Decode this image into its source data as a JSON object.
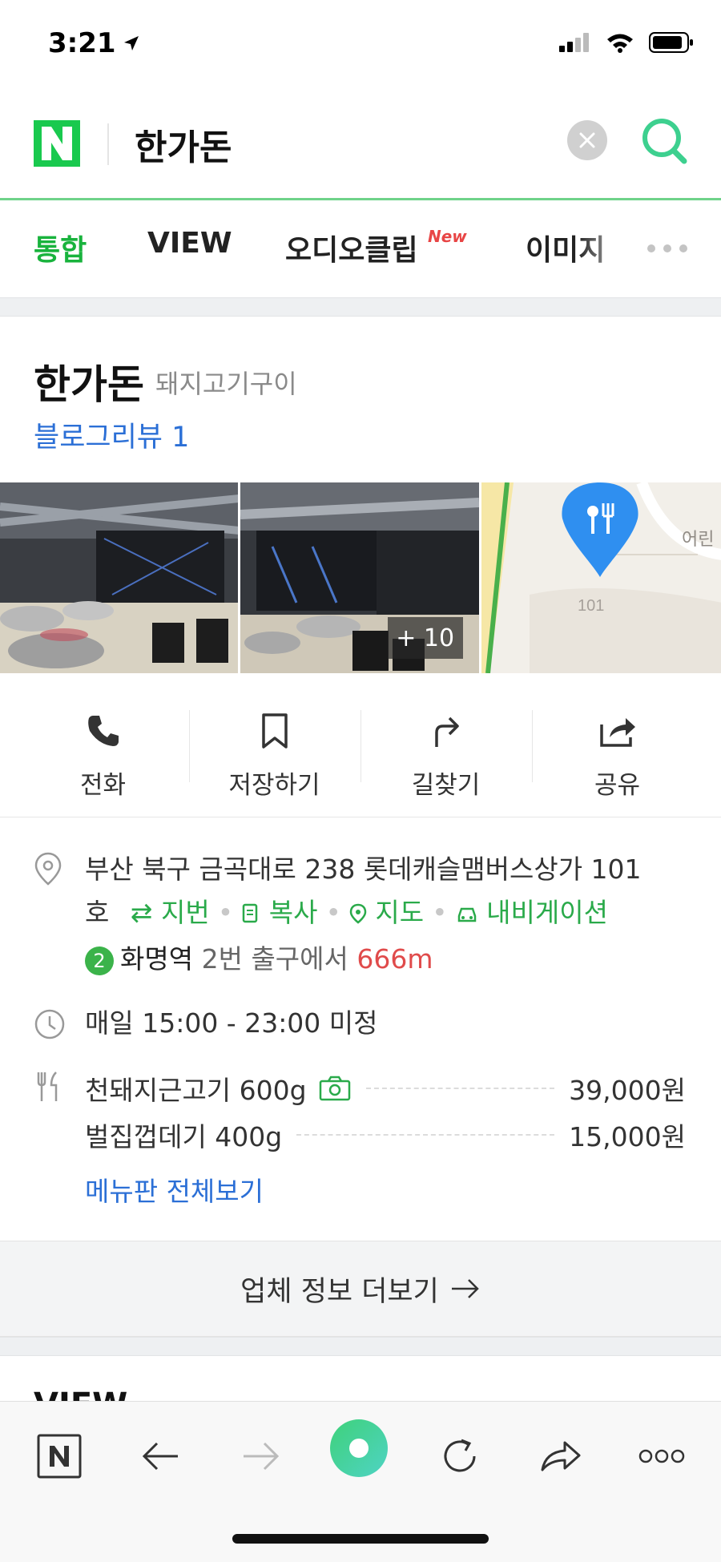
{
  "status_bar": {
    "time": "3:21"
  },
  "search": {
    "query": "한가돈"
  },
  "tabs": [
    {
      "label": "통합",
      "active": true
    },
    {
      "label": "VIEW",
      "active": false
    },
    {
      "label": "오디오클립",
      "active": false,
      "badge": "New"
    },
    {
      "label": "이미지",
      "active": false
    }
  ],
  "place": {
    "name": "한가돈",
    "category": "돼지고기구이",
    "blog_review": "블로그리뷰 1",
    "photo_more": "+ 10",
    "map_labels": {
      "street": "101",
      "nearby": "어린"
    }
  },
  "actions": [
    {
      "label": "전화",
      "icon": "phone-icon"
    },
    {
      "label": "저장하기",
      "icon": "bookmark-icon"
    },
    {
      "label": "길찾기",
      "icon": "directions-icon"
    },
    {
      "label": "공유",
      "icon": "share-icon"
    }
  ],
  "address": {
    "text": "부산 북구 금곡대로 238 롯데캐슬맴버스상가 101호",
    "line1": "부산 북구 금곡대로 238 롯데캐슬맴버스상가 101",
    "line2_prefix": "호",
    "links": [
      "지번",
      "복사",
      "지도",
      "내비게이션"
    ],
    "subway": {
      "line": "2",
      "station": "화명역",
      "exit": "2번 출구에서",
      "distance": "666m"
    }
  },
  "hours": "매일 15:00 - 23:00 미정",
  "menu": [
    {
      "name": "천돼지근고기 600g",
      "price": "39,000원",
      "has_photo": true
    },
    {
      "name": "벌집껍데기 400g",
      "price": "15,000원",
      "has_photo": false
    }
  ],
  "menu_link": "메뉴판 전체보기",
  "more_info": "업체 정보 더보기",
  "next_section": "VIEW",
  "colors": {
    "naver_green": "#19b33d",
    "link_blue": "#2b6fd6",
    "distance_red": "#e04b4b"
  }
}
